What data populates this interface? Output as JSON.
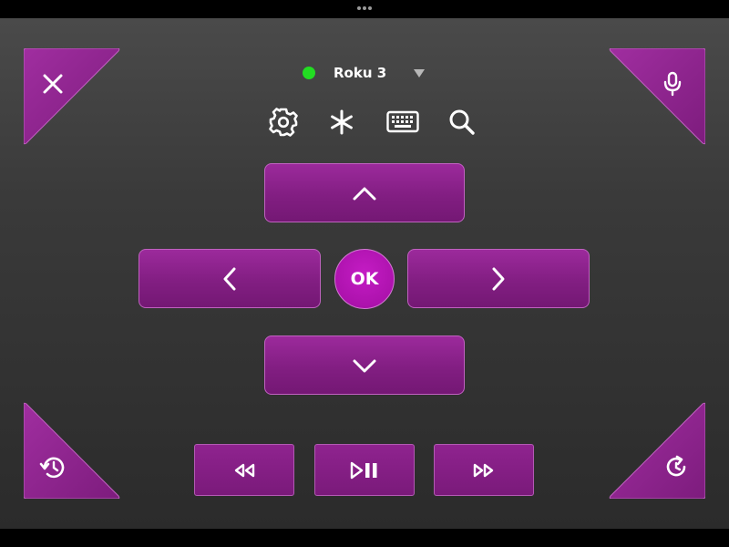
{
  "device": {
    "name": "Roku 3",
    "status_color": "#22dd22"
  },
  "colors": {
    "accent": "#8a1f8a",
    "ok_button": "#b016b0",
    "background": "#3a3a3a",
    "icon": "#ffffff"
  },
  "buttons": {
    "ok_label": "OK",
    "corner_top_left": "close-icon",
    "corner_top_right": "microphone-icon",
    "corner_bottom_left": "history-icon",
    "corner_bottom_right": "replay-icon"
  },
  "toolbar": [
    "gear-icon",
    "asterisk-icon",
    "keyboard-icon",
    "search-icon"
  ],
  "media": [
    "rewind-icon",
    "play-pause-icon",
    "fast-forward-icon"
  ]
}
